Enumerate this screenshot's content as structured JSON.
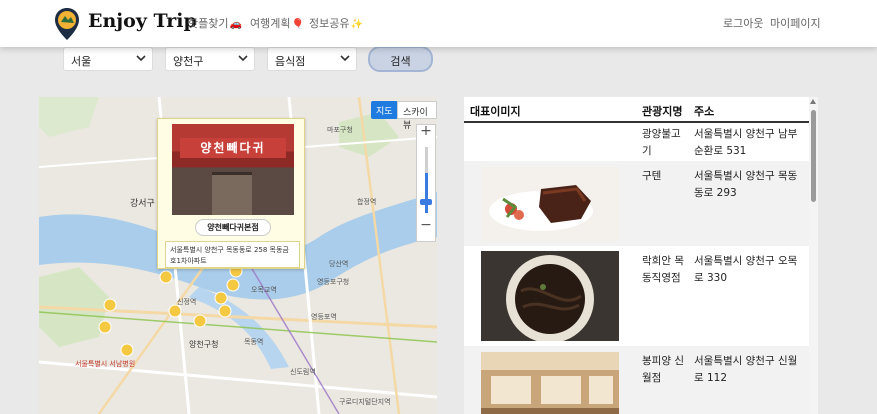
{
  "nav": {
    "brand": "Enjoy Trip",
    "links": [
      {
        "label": "핫플찾기",
        "emoji": "🚗"
      },
      {
        "label": "여행계획",
        "emoji": "🎈"
      },
      {
        "label": "정보공유",
        "emoji": "✨"
      }
    ],
    "login": "로그아웃",
    "mypage": "마이페이지"
  },
  "search": {
    "sido": "서울",
    "gugun": "양천구",
    "content_type": "음식점",
    "button": "검색"
  },
  "map": {
    "type_map": "지도",
    "type_skyview": "스카이뷰",
    "zoom_in": "+",
    "zoom_out": "−",
    "labels": [
      "마포구청",
      "강서구",
      "영등포구청",
      "양천구청",
      "신정역",
      "목동역",
      "오목교역",
      "당산역",
      "합정역",
      "영등포역",
      "신도림역",
      "구로디지털단지역",
      "서울특별시 서남병원"
    ],
    "info": {
      "sign": "양천빼다귀",
      "title": "양천빼다귀본점",
      "address": "서울특별시 양천구 목동동로 258 목동금호1차아파트"
    }
  },
  "table": {
    "headers": [
      "대표이미지",
      "관광지명",
      "주소"
    ],
    "rows": [
      {
        "name": "광양불고기",
        "address": "서울특별시 양천구 남부순환로 531",
        "image": ""
      },
      {
        "name": "구텐",
        "address": "서울특별시 양천구 목동동로 293",
        "image": "dish-steak"
      },
      {
        "name": "락희안 목동직영점",
        "address": "서울특별시 양천구 오목로 330",
        "image": "dish-jjajang"
      },
      {
        "name": "봉피양 신월점",
        "address": "서울특별시 양천구 신월로 112",
        "image": "interior"
      }
    ]
  },
  "colors": {
    "accent_blue": "#1f7be0",
    "search_button": "#c9d3e4",
    "info_bg": "#fffde3",
    "marker": "#f5c842"
  }
}
